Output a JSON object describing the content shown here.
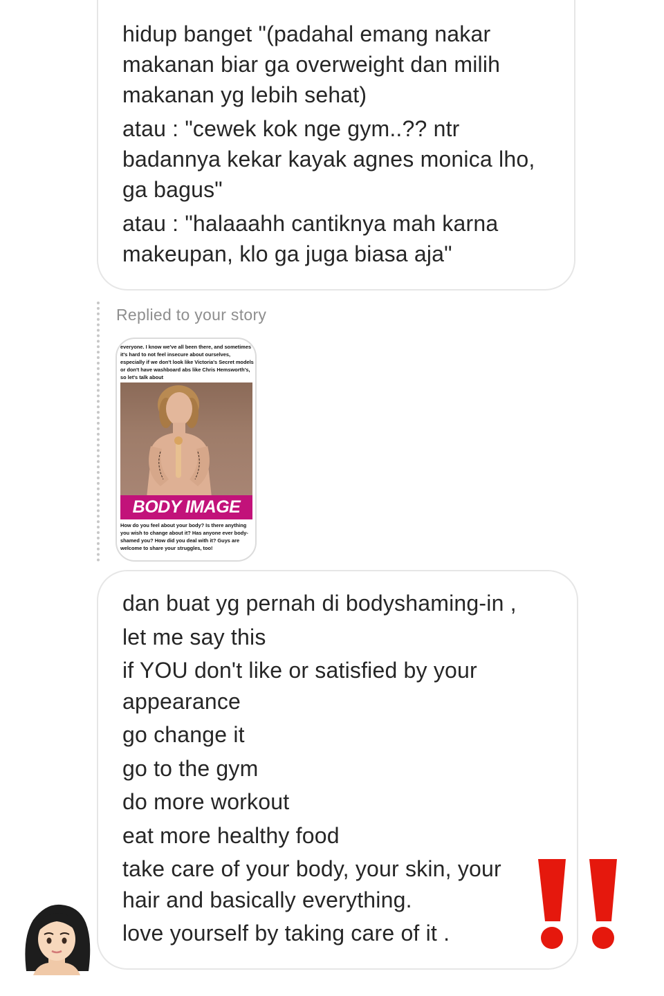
{
  "messages": {
    "top": {
      "lines": [
        "hidup banget \"(padahal emang nakar",
        "makanan biar ga overweight dan milih",
        "makanan yg lebih sehat)",
        "atau : \"cewek kok nge gym..?? ntr",
        "badannya kekar kayak agnes monica lho,",
        "ga bagus\"",
        "atau : \"halaaahh cantiknya mah karna",
        "makeupan, klo ga juga biasa aja\""
      ]
    },
    "reply": {
      "label": "Replied to your story",
      "story": {
        "top_text": "everyone. I know we've all been there, and sometimes it's hard to not feel insecure about ourselves, especially if we don't look like Victoria's Secret models or don't have washboard abs like Chris Hemsworth's, so let's talk about",
        "banner": "BODY IMAGE",
        "bottom_text": "How do you feel about your body? Is there anything you wish to change about it? Has anyone ever body-shamed you? How did you deal with it? Guys are welcome to share your struggles, too!"
      }
    },
    "bottom": {
      "lines": [
        "dan buat yg pernah di bodyshaming-in  ,",
        "let me say this",
        "if YOU don't like or satisfied by your",
        "appearance",
        "go change it",
        "go to the gym",
        "do more workout",
        "eat more healthy food",
        "take care of your body, your skin, your",
        "hair and basically everything.",
        "love yourself by taking care of it ."
      ]
    }
  },
  "icons": {
    "avatar": "woman-emoji-icon",
    "reaction": "double-exclamation-icon"
  },
  "colors": {
    "bubble_border": "#e6e6e6",
    "text": "#262626",
    "muted": "#8e8e8e",
    "banner": "#c2127a",
    "exclaim": "#e5180d"
  }
}
